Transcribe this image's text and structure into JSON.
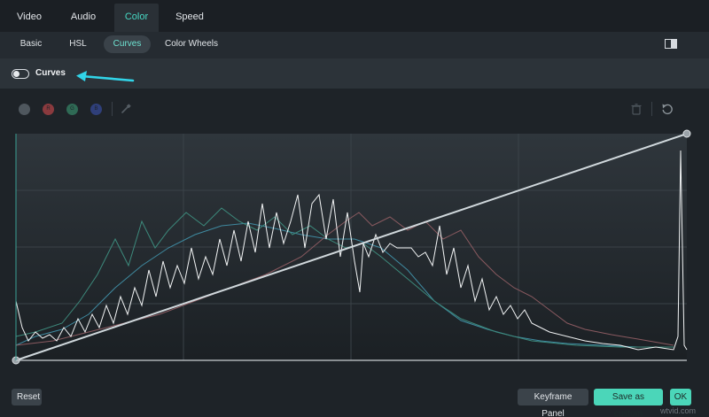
{
  "top_tabs": [
    {
      "label": "Video",
      "active": false
    },
    {
      "label": "Audio",
      "active": false
    },
    {
      "label": "Color",
      "active": true
    },
    {
      "label": "Speed",
      "active": false
    }
  ],
  "sub_tabs": [
    {
      "label": "Basic",
      "active": false
    },
    {
      "label": "HSL",
      "active": false
    },
    {
      "label": "Curves",
      "active": true
    },
    {
      "label": "Color Wheels",
      "active": false
    }
  ],
  "curves_toggle": {
    "label": "Curves",
    "enabled": false
  },
  "channels": [
    {
      "name": "rgb-channel-icon",
      "letter": "",
      "color": "#4f575e"
    },
    {
      "name": "red-channel-icon",
      "letter": "R",
      "color": "#8a3a3e"
    },
    {
      "name": "green-channel-icon",
      "letter": "G",
      "color": "#2f6a55"
    },
    {
      "name": "blue-channel-icon",
      "letter": "B",
      "color": "#2f3f7a"
    }
  ],
  "colors": {
    "accent": "#47d8c4",
    "annotation_arrow": "#31d4e8",
    "curve_line": "#d0d8dc",
    "histogram_luma": "#f2f4f5",
    "histogram_red": "#8a5a60",
    "histogram_green": "#3d8a7c",
    "histogram_blue": "#3f8aa0"
  },
  "buttons": {
    "reset": "Reset",
    "keyframe_panel": "Keyframe Panel",
    "save_as_custom": "Save as custom",
    "ok": "OK"
  },
  "watermark": "wtvid.com"
}
